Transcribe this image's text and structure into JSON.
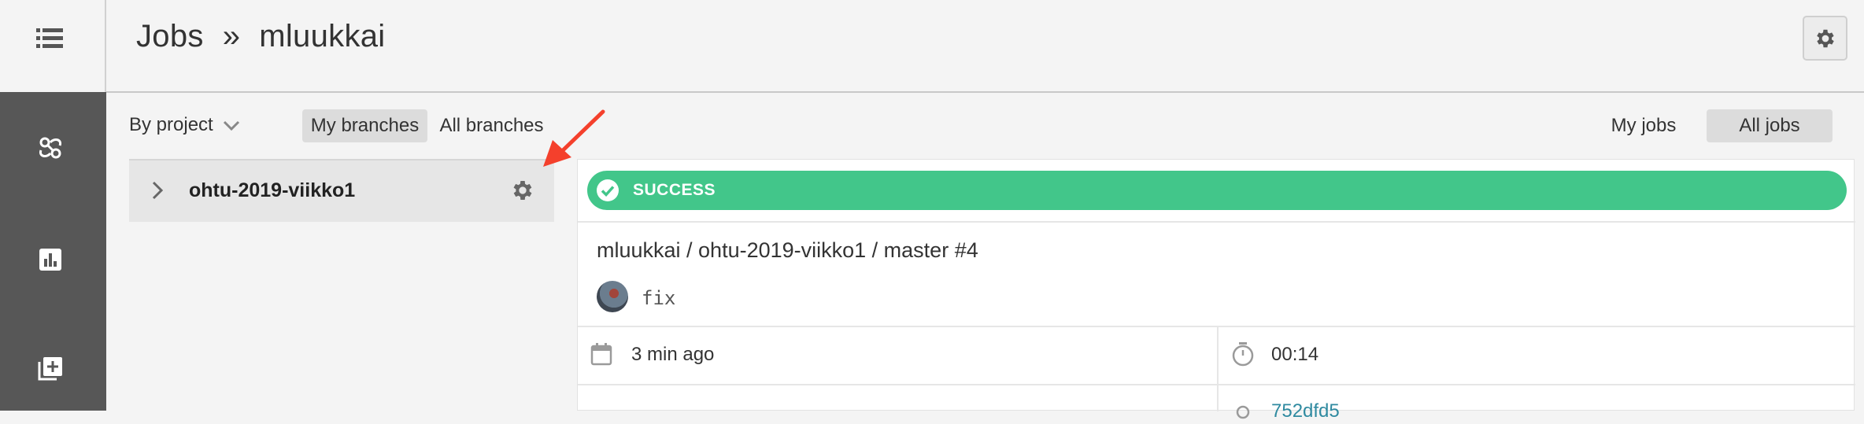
{
  "breadcrumb": {
    "root": "Jobs",
    "separator": "»",
    "current": "mluukkai"
  },
  "filters": {
    "group_by": "By project",
    "branch_tabs": [
      {
        "label": "My branches",
        "active": true
      },
      {
        "label": "All branches",
        "active": false
      }
    ],
    "job_tabs": [
      {
        "label": "My jobs",
        "active": false
      },
      {
        "label": "All jobs",
        "active": true
      }
    ]
  },
  "projects": [
    {
      "name": "ohtu-2019-viikko1"
    }
  ],
  "job": {
    "status": "SUCCESS",
    "title": "mluukkai / ohtu-2019-viikko1 / master #4",
    "commit_message": "fix",
    "started": "3 min ago",
    "duration": "00:14",
    "commit_hash": "752dfd5"
  },
  "icons": {
    "menu": "menu-list-icon",
    "side": [
      "branch-graph-icon",
      "bar-chart-icon",
      "add-box-icon"
    ],
    "settings": "gear-icon"
  },
  "colors": {
    "success": "#42c68a",
    "sidebar": "#575757",
    "link": "#2f8aa0",
    "annotation_arrow": "#f4402c"
  }
}
